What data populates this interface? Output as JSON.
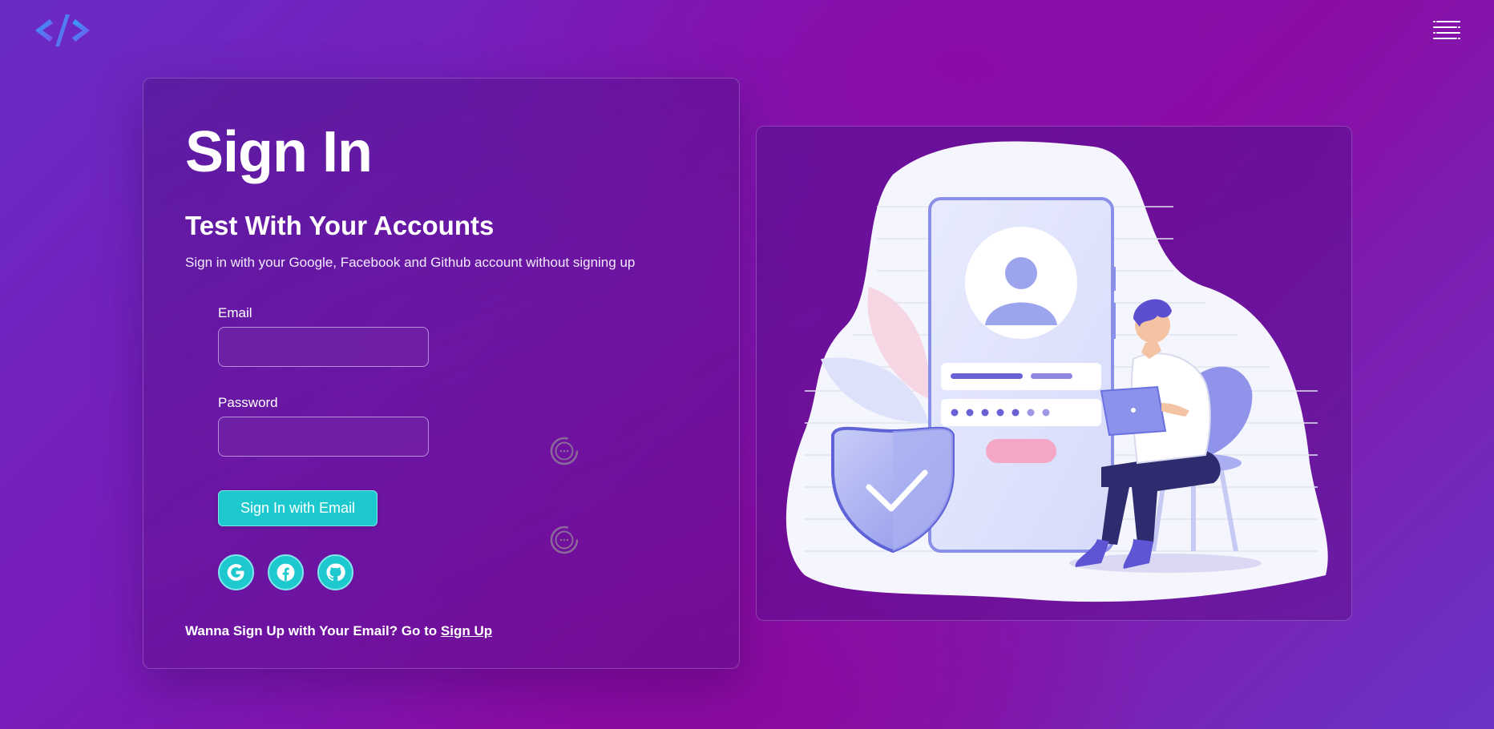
{
  "header": {
    "logo_icon": "code-brackets-icon",
    "menu_icon": "hamburger-menu-icon"
  },
  "signin": {
    "title": "Sign In",
    "subtitle": "Test With Your Accounts",
    "description": "Sign in with your Google, Facebook and Github account without signing up",
    "email_label": "Email",
    "email_value": "",
    "email_placeholder": "",
    "password_label": "Password",
    "password_value": "",
    "password_placeholder": "",
    "submit_label": "Sign In with Email",
    "social": [
      {
        "name": "google",
        "icon": "google-icon"
      },
      {
        "name": "facebook",
        "icon": "facebook-icon"
      },
      {
        "name": "github",
        "icon": "github-icon"
      }
    ],
    "footer_text": "Wanna Sign Up with Your Email? Go to",
    "footer_link": "Sign Up"
  },
  "illustration": {
    "subject": "person-with-laptop-login-phone-illustration"
  },
  "colors": {
    "accent": "#1ec8cf",
    "background_primary": "#7a1bb8",
    "background_secondary": "#8a0ca6",
    "logo_blue": "#3a8ef0",
    "logo_purple": "#7a5af0"
  }
}
